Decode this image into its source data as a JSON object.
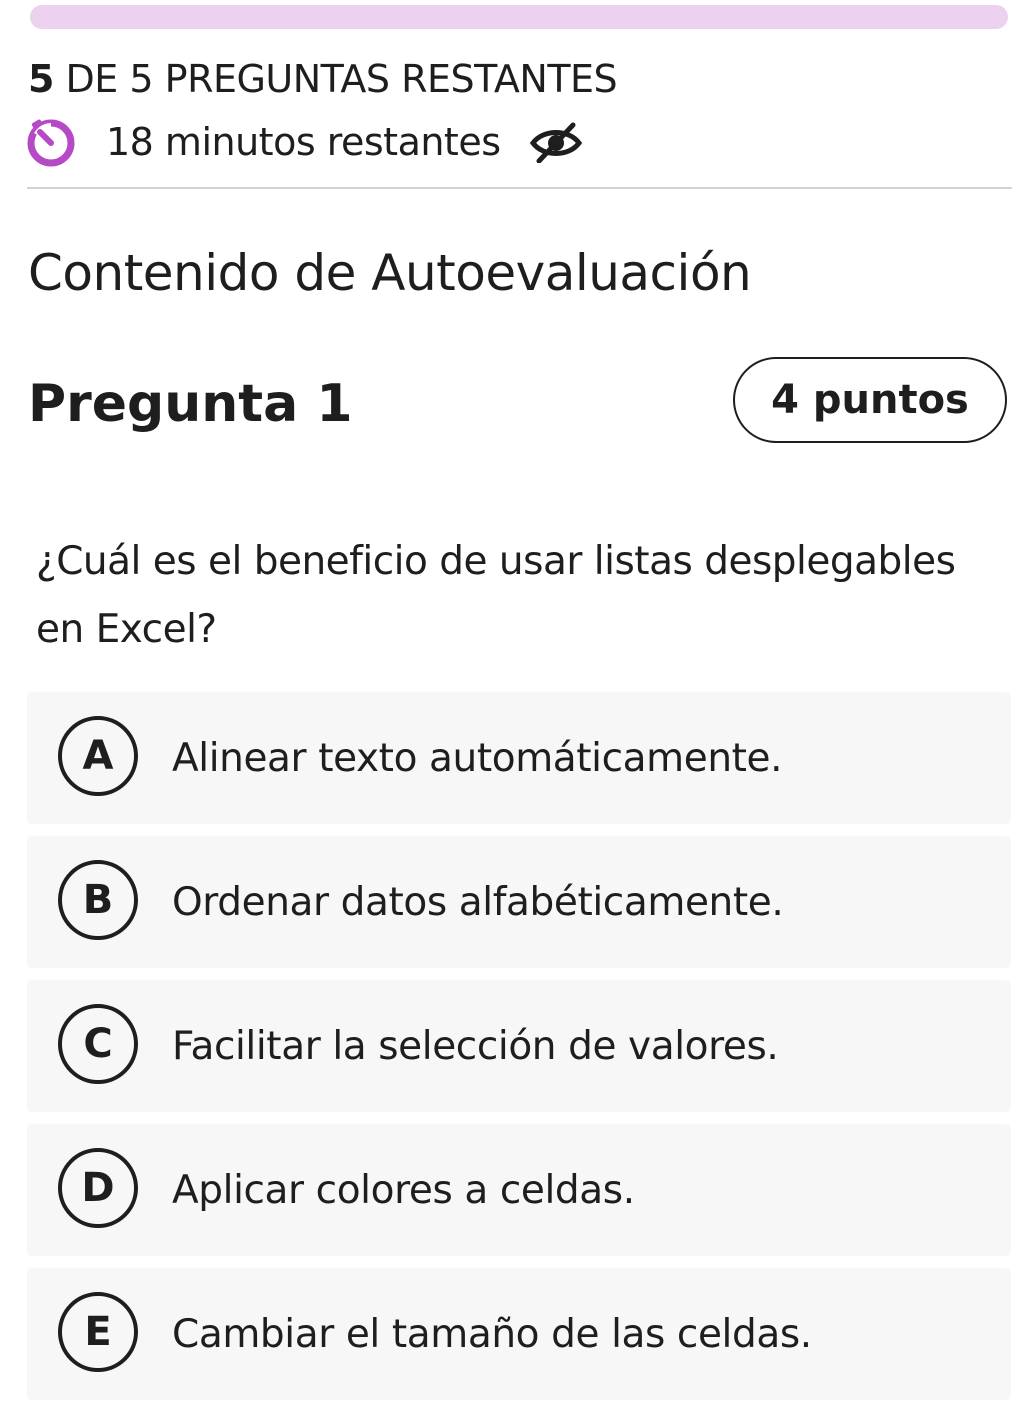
{
  "progress": {
    "fraction": 1.0,
    "color": "#ecd2ee"
  },
  "header": {
    "remaining_number": "5",
    "remaining_text": "DE 5 PREGUNTAS RESTANTES",
    "timer_text": "18 minutos restantes",
    "timer_icon": "timer-icon",
    "toggle_icon": "eye-hidden-icon",
    "accent_color": "#b549c6"
  },
  "section": {
    "title": "Contenido de Autoevaluación"
  },
  "question": {
    "title": "Pregunta 1",
    "points": "4 puntos",
    "text": "¿Cuál es el beneficio de usar listas desplegables en Excel?",
    "options": [
      {
        "letter": "A",
        "text": "Alinear texto automáticamente."
      },
      {
        "letter": "B",
        "text": "Ordenar datos alfabéticamente."
      },
      {
        "letter": "C",
        "text": "Facilitar la selección de valores."
      },
      {
        "letter": "D",
        "text": "Aplicar colores a celdas."
      },
      {
        "letter": "E",
        "text": "Cambiar el tamaño de las celdas."
      }
    ]
  }
}
